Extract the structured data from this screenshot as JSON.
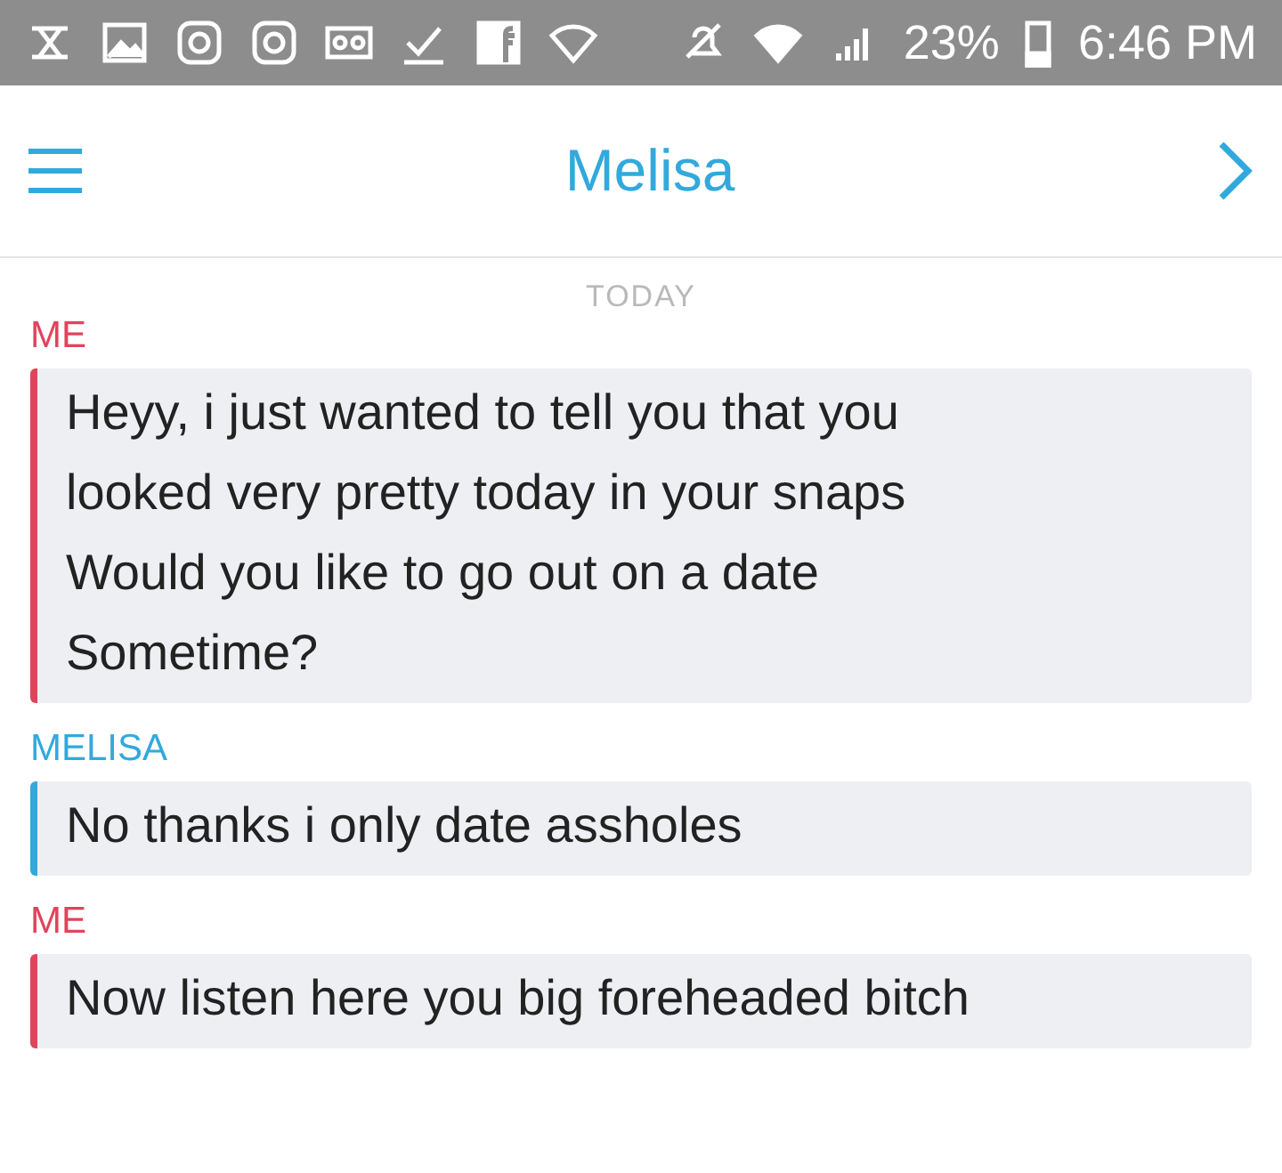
{
  "status_bar": {
    "battery": "23%",
    "time": "6:46 PM"
  },
  "header": {
    "title": "Melisa"
  },
  "date_divider": "TODAY",
  "groups": [
    {
      "sender": "ME",
      "kind": "me",
      "messages": [
        "Heyy, i just wanted to tell you that you\nlooked very pretty today in your snaps",
        "Would you like to go out on a date\nSometime?"
      ]
    },
    {
      "sender": "MELISA",
      "kind": "them",
      "messages": [
        "No thanks i only date assholes"
      ]
    },
    {
      "sender": "ME",
      "kind": "me",
      "messages": [
        "Now listen here you big foreheaded bitch"
      ]
    }
  ]
}
